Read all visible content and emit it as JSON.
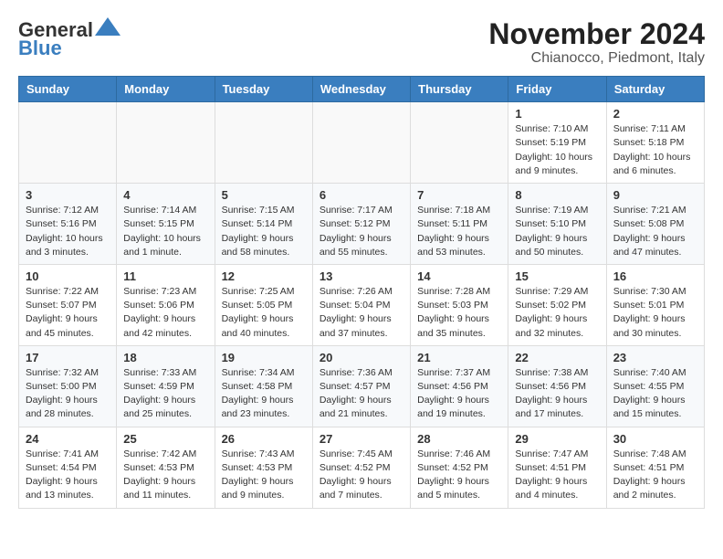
{
  "header": {
    "logo_line1": "General",
    "logo_line2": "Blue",
    "title": "November 2024",
    "subtitle": "Chianocco, Piedmont, Italy"
  },
  "weekdays": [
    "Sunday",
    "Monday",
    "Tuesday",
    "Wednesday",
    "Thursday",
    "Friday",
    "Saturday"
  ],
  "weeks": [
    [
      {
        "day": "",
        "info": ""
      },
      {
        "day": "",
        "info": ""
      },
      {
        "day": "",
        "info": ""
      },
      {
        "day": "",
        "info": ""
      },
      {
        "day": "",
        "info": ""
      },
      {
        "day": "1",
        "info": "Sunrise: 7:10 AM\nSunset: 5:19 PM\nDaylight: 10 hours\nand 9 minutes."
      },
      {
        "day": "2",
        "info": "Sunrise: 7:11 AM\nSunset: 5:18 PM\nDaylight: 10 hours\nand 6 minutes."
      }
    ],
    [
      {
        "day": "3",
        "info": "Sunrise: 7:12 AM\nSunset: 5:16 PM\nDaylight: 10 hours\nand 3 minutes."
      },
      {
        "day": "4",
        "info": "Sunrise: 7:14 AM\nSunset: 5:15 PM\nDaylight: 10 hours\nand 1 minute."
      },
      {
        "day": "5",
        "info": "Sunrise: 7:15 AM\nSunset: 5:14 PM\nDaylight: 9 hours\nand 58 minutes."
      },
      {
        "day": "6",
        "info": "Sunrise: 7:17 AM\nSunset: 5:12 PM\nDaylight: 9 hours\nand 55 minutes."
      },
      {
        "day": "7",
        "info": "Sunrise: 7:18 AM\nSunset: 5:11 PM\nDaylight: 9 hours\nand 53 minutes."
      },
      {
        "day": "8",
        "info": "Sunrise: 7:19 AM\nSunset: 5:10 PM\nDaylight: 9 hours\nand 50 minutes."
      },
      {
        "day": "9",
        "info": "Sunrise: 7:21 AM\nSunset: 5:08 PM\nDaylight: 9 hours\nand 47 minutes."
      }
    ],
    [
      {
        "day": "10",
        "info": "Sunrise: 7:22 AM\nSunset: 5:07 PM\nDaylight: 9 hours\nand 45 minutes."
      },
      {
        "day": "11",
        "info": "Sunrise: 7:23 AM\nSunset: 5:06 PM\nDaylight: 9 hours\nand 42 minutes."
      },
      {
        "day": "12",
        "info": "Sunrise: 7:25 AM\nSunset: 5:05 PM\nDaylight: 9 hours\nand 40 minutes."
      },
      {
        "day": "13",
        "info": "Sunrise: 7:26 AM\nSunset: 5:04 PM\nDaylight: 9 hours\nand 37 minutes."
      },
      {
        "day": "14",
        "info": "Sunrise: 7:28 AM\nSunset: 5:03 PM\nDaylight: 9 hours\nand 35 minutes."
      },
      {
        "day": "15",
        "info": "Sunrise: 7:29 AM\nSunset: 5:02 PM\nDaylight: 9 hours\nand 32 minutes."
      },
      {
        "day": "16",
        "info": "Sunrise: 7:30 AM\nSunset: 5:01 PM\nDaylight: 9 hours\nand 30 minutes."
      }
    ],
    [
      {
        "day": "17",
        "info": "Sunrise: 7:32 AM\nSunset: 5:00 PM\nDaylight: 9 hours\nand 28 minutes."
      },
      {
        "day": "18",
        "info": "Sunrise: 7:33 AM\nSunset: 4:59 PM\nDaylight: 9 hours\nand 25 minutes."
      },
      {
        "day": "19",
        "info": "Sunrise: 7:34 AM\nSunset: 4:58 PM\nDaylight: 9 hours\nand 23 minutes."
      },
      {
        "day": "20",
        "info": "Sunrise: 7:36 AM\nSunset: 4:57 PM\nDaylight: 9 hours\nand 21 minutes."
      },
      {
        "day": "21",
        "info": "Sunrise: 7:37 AM\nSunset: 4:56 PM\nDaylight: 9 hours\nand 19 minutes."
      },
      {
        "day": "22",
        "info": "Sunrise: 7:38 AM\nSunset: 4:56 PM\nDaylight: 9 hours\nand 17 minutes."
      },
      {
        "day": "23",
        "info": "Sunrise: 7:40 AM\nSunset: 4:55 PM\nDaylight: 9 hours\nand 15 minutes."
      }
    ],
    [
      {
        "day": "24",
        "info": "Sunrise: 7:41 AM\nSunset: 4:54 PM\nDaylight: 9 hours\nand 13 minutes."
      },
      {
        "day": "25",
        "info": "Sunrise: 7:42 AM\nSunset: 4:53 PM\nDaylight: 9 hours\nand 11 minutes."
      },
      {
        "day": "26",
        "info": "Sunrise: 7:43 AM\nSunset: 4:53 PM\nDaylight: 9 hours\nand 9 minutes."
      },
      {
        "day": "27",
        "info": "Sunrise: 7:45 AM\nSunset: 4:52 PM\nDaylight: 9 hours\nand 7 minutes."
      },
      {
        "day": "28",
        "info": "Sunrise: 7:46 AM\nSunset: 4:52 PM\nDaylight: 9 hours\nand 5 minutes."
      },
      {
        "day": "29",
        "info": "Sunrise: 7:47 AM\nSunset: 4:51 PM\nDaylight: 9 hours\nand 4 minutes."
      },
      {
        "day": "30",
        "info": "Sunrise: 7:48 AM\nSunset: 4:51 PM\nDaylight: 9 hours\nand 2 minutes."
      }
    ]
  ]
}
